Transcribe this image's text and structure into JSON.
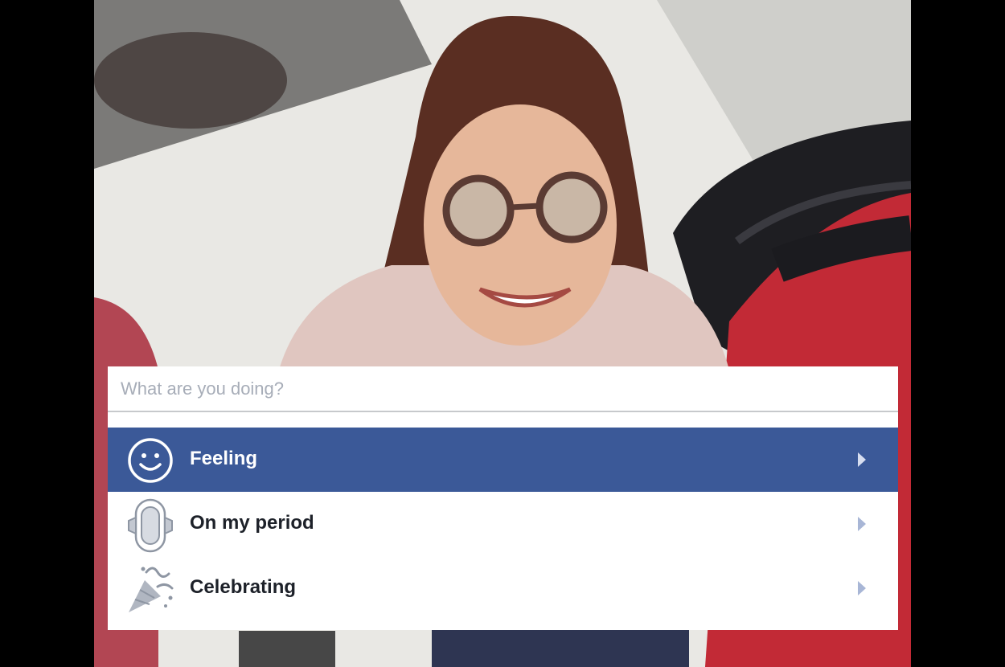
{
  "composer": {
    "search_placeholder": "What are you doing?",
    "search_value": ""
  },
  "options": [
    {
      "label": "Feeling",
      "icon": "smiley-face-icon",
      "selected": true
    },
    {
      "label": "On my period",
      "icon": "sanitary-pad-icon",
      "selected": false
    },
    {
      "label": "Celebrating",
      "icon": "party-popper-icon",
      "selected": false
    }
  ],
  "colors": {
    "selected_row": "#3b5998",
    "placeholder": "#a7adb8",
    "label": "#1d2129",
    "chevron": "#a8b6d6"
  }
}
